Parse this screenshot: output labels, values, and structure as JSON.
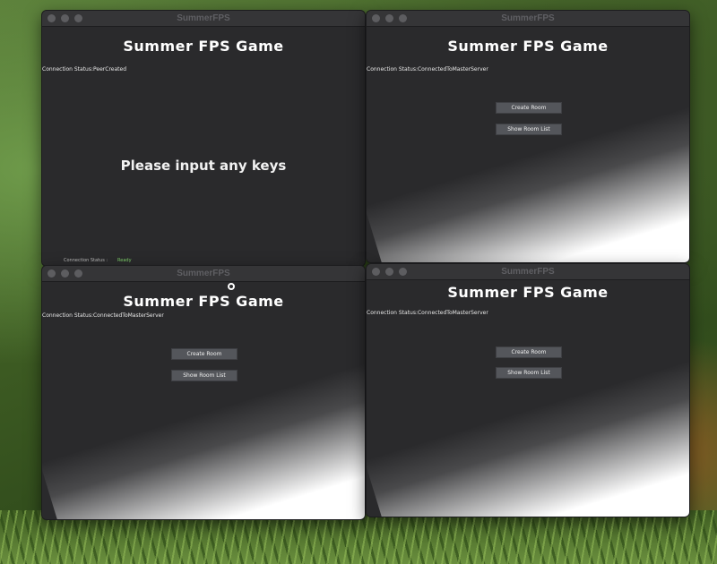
{
  "windows": [
    {
      "title": "SummerFPS",
      "game_title": "Summer FPS Game",
      "status": "Connection Status:PeerCreated",
      "prompt": "Please input any keys",
      "bottom_status_label": "Connection Status :",
      "bottom_status_value": "Ready"
    },
    {
      "title": "SummerFPS",
      "game_title": "Summer FPS Game",
      "status": "Connection Status:ConnectedToMasterServer",
      "create_room_label": "Create Room",
      "show_room_list_label": "Show Room List"
    },
    {
      "title": "SummerFPS",
      "game_title": "Summer FPS Game",
      "status": "Connection Status:ConnectedToMasterServer",
      "create_room_label": "Create Room",
      "show_room_list_label": "Show Room List"
    },
    {
      "title": "SummerFPS",
      "game_title": "Summer FPS Game",
      "status": "Connection Status:ConnectedToMasterServer",
      "create_room_label": "Create Room",
      "show_room_list_label": "Show Room List"
    }
  ],
  "colors": {
    "window_bg": "#2a2a2c",
    "button_bg": "#54565b",
    "ready_green": "#7fd36b"
  }
}
